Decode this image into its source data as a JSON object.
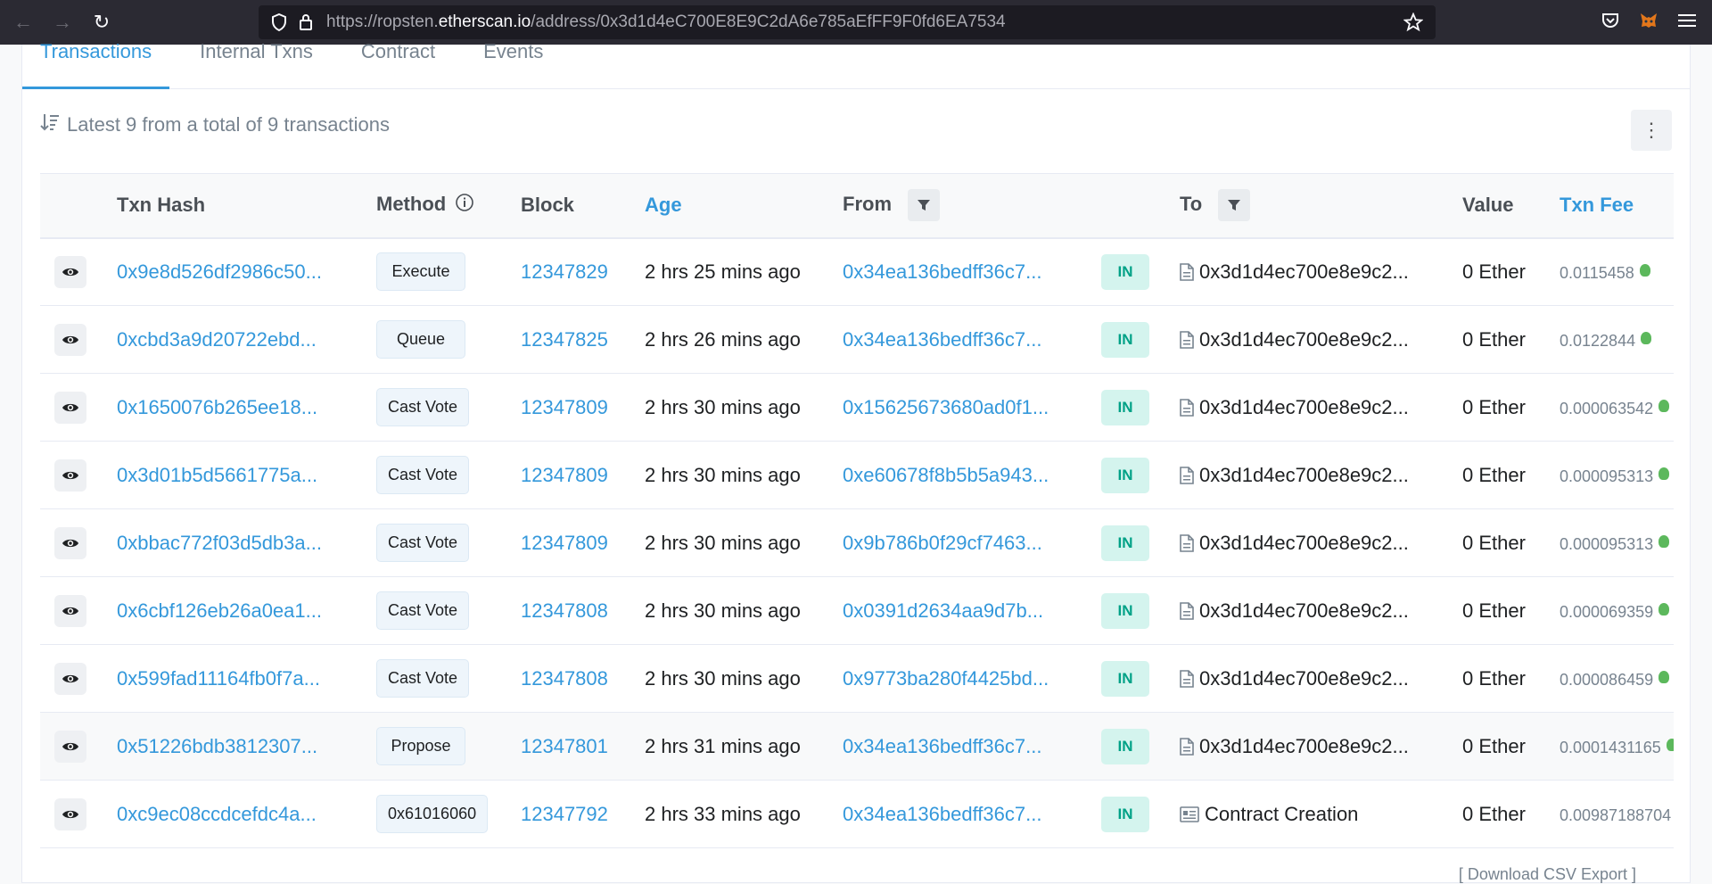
{
  "browser": {
    "url_prefix": "https://ropsten.",
    "url_domain": "etherscan.io",
    "url_path": "/address/0x3d1d4eC700E8E9C2dA6e785aEfFF9F0fd6EA7534"
  },
  "tabs": [
    {
      "label": "Transactions"
    },
    {
      "label": "Internal Txns"
    },
    {
      "label": "Contract"
    },
    {
      "label": "Events"
    }
  ],
  "summary": "Latest 9 from a total of 9 transactions",
  "headers": {
    "txn_hash": "Txn Hash",
    "method": "Method",
    "block": "Block",
    "age": "Age",
    "from": "From",
    "to": "To",
    "value": "Value",
    "txn_fee": "Txn Fee"
  },
  "rows": [
    {
      "hash": "0x9e8d526df2986c50...",
      "method": "Execute",
      "block": "12347829",
      "age": "2 hrs 25 mins ago",
      "from": "0x34ea136bedff36c7...",
      "dir": "IN",
      "to": "0x3d1d4ec700e8e9c2...",
      "value": "0 Ether",
      "fee": "0.0115458"
    },
    {
      "hash": "0xcbd3a9d20722ebd...",
      "method": "Queue",
      "block": "12347825",
      "age": "2 hrs 26 mins ago",
      "from": "0x34ea136bedff36c7...",
      "dir": "IN",
      "to": "0x3d1d4ec700e8e9c2...",
      "value": "0 Ether",
      "fee": "0.0122844"
    },
    {
      "hash": "0x1650076b265ee18...",
      "method": "Cast Vote",
      "block": "12347809",
      "age": "2 hrs 30 mins ago",
      "from": "0x15625673680ad0f1...",
      "dir": "IN",
      "to": "0x3d1d4ec700e8e9c2...",
      "value": "0 Ether",
      "fee": "0.000063542"
    },
    {
      "hash": "0x3d01b5d5661775a...",
      "method": "Cast Vote",
      "block": "12347809",
      "age": "2 hrs 30 mins ago",
      "from": "0xe60678f8b5b5a943...",
      "dir": "IN",
      "to": "0x3d1d4ec700e8e9c2...",
      "value": "0 Ether",
      "fee": "0.000095313"
    },
    {
      "hash": "0xbbac772f03d5db3a...",
      "method": "Cast Vote",
      "block": "12347809",
      "age": "2 hrs 30 mins ago",
      "from": "0x9b786b0f29cf7463...",
      "dir": "IN",
      "to": "0x3d1d4ec700e8e9c2...",
      "value": "0 Ether",
      "fee": "0.000095313"
    },
    {
      "hash": "0x6cbf126eb26a0ea1...",
      "method": "Cast Vote",
      "block": "12347808",
      "age": "2 hrs 30 mins ago",
      "from": "0x0391d2634aa9d7b...",
      "dir": "IN",
      "to": "0x3d1d4ec700e8e9c2...",
      "value": "0 Ether",
      "fee": "0.000069359"
    },
    {
      "hash": "0x599fad11164fb0f7a...",
      "method": "Cast Vote",
      "block": "12347808",
      "age": "2 hrs 30 mins ago",
      "from": "0x9773ba280f4425bd...",
      "dir": "IN",
      "to": "0x3d1d4ec700e8e9c2...",
      "value": "0 Ether",
      "fee": "0.000086459"
    },
    {
      "hash": "0x51226bdb3812307...",
      "method": "Propose",
      "block": "12347801",
      "age": "2 hrs 31 mins ago",
      "from": "0x34ea136bedff36c7...",
      "dir": "IN",
      "to": "0x3d1d4ec700e8e9c2...",
      "value": "0 Ether",
      "fee": "0.0001431165"
    },
    {
      "hash": "0xc9ec08ccdcefdc4a...",
      "method": "0x61016060",
      "block": "12347792",
      "age": "2 hrs 33 mins ago",
      "from": "0x34ea136bedff36c7...",
      "dir": "IN",
      "to": "Contract Creation",
      "value": "0 Ether",
      "fee": "0.00987188704"
    }
  ],
  "footer_hint": "[ Download CSV Export ]"
}
